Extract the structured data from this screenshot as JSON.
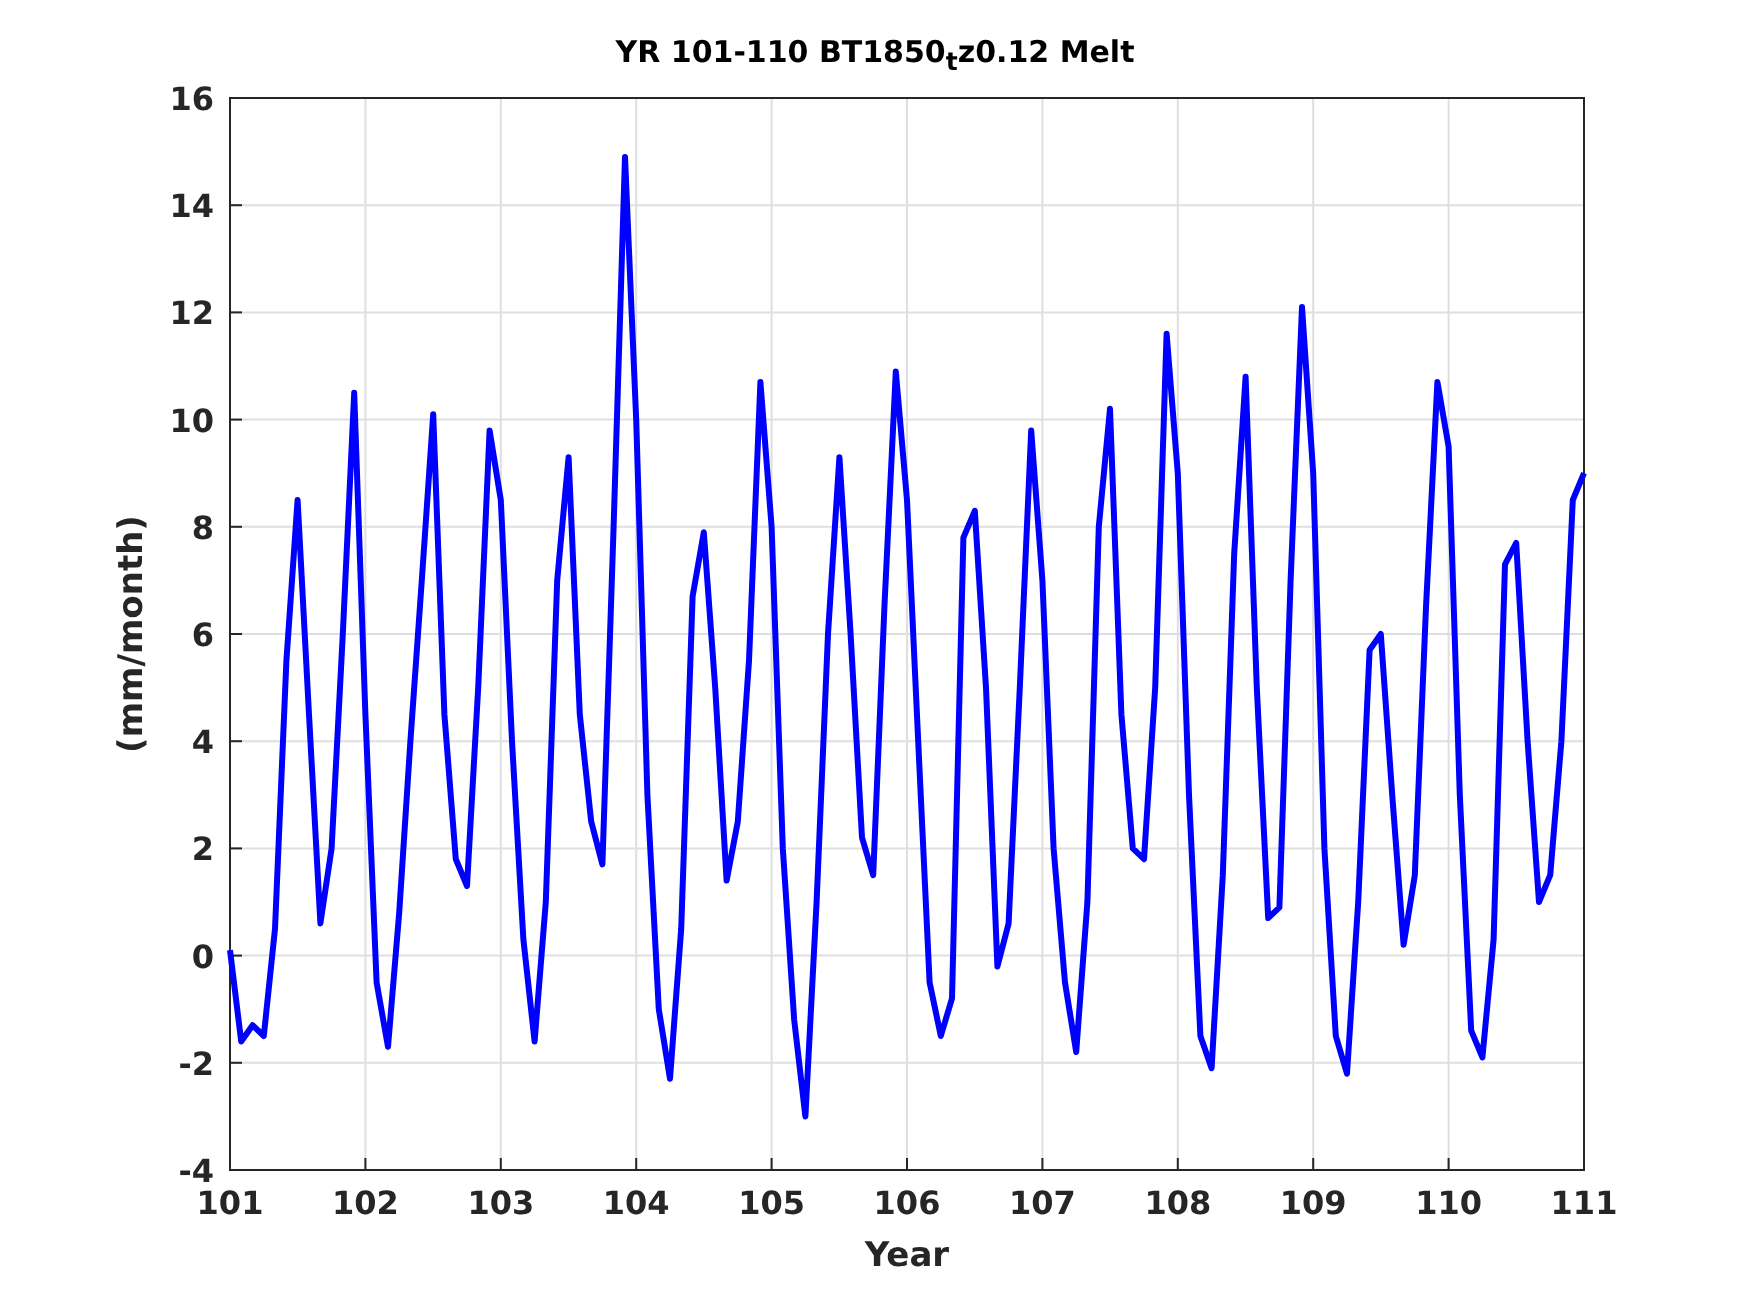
{
  "figure": {
    "chart_data": {
      "type": "line",
      "title": "YR 101-110 BT1850$_{t}$z0.12 Melt",
      "xlabel": "Year",
      "ylabel": "(mm/month)",
      "x": [
        101,
        101.083,
        101.167,
        101.25,
        101.333,
        101.417,
        101.5,
        101.583,
        101.667,
        101.75,
        101.833,
        101.917,
        102,
        102.083,
        102.167,
        102.25,
        102.333,
        102.417,
        102.5,
        102.583,
        102.667,
        102.75,
        102.833,
        102.917,
        103,
        103.083,
        103.167,
        103.25,
        103.333,
        103.417,
        103.5,
        103.583,
        103.667,
        103.75,
        103.833,
        103.917,
        104,
        104.083,
        104.167,
        104.25,
        104.333,
        104.417,
        104.5,
        104.583,
        104.667,
        104.75,
        104.833,
        104.917,
        105,
        105.083,
        105.167,
        105.25,
        105.333,
        105.417,
        105.5,
        105.583,
        105.667,
        105.75,
        105.833,
        105.917,
        106,
        106.083,
        106.167,
        106.25,
        106.333,
        106.417,
        106.5,
        106.583,
        106.667,
        106.75,
        106.833,
        106.917,
        107,
        107.083,
        107.167,
        107.25,
        107.333,
        107.417,
        107.5,
        107.583,
        107.667,
        107.75,
        107.833,
        107.917,
        108,
        108.083,
        108.167,
        108.25,
        108.333,
        108.417,
        108.5,
        108.583,
        108.667,
        108.75,
        108.833,
        108.917,
        109,
        109.083,
        109.167,
        109.25,
        109.333,
        109.417,
        109.5,
        109.583,
        109.667,
        109.75,
        109.833,
        109.917,
        110,
        110.083,
        110.167,
        110.25,
        110.333,
        110.417,
        110.5,
        110.583,
        110.667,
        110.75,
        110.833,
        110.917,
        111
      ],
      "grid": true,
      "series": [
        {
          "color": "#0000ff",
          "values": [
            0.1,
            -1.6,
            -1.3,
            -1.5,
            0.5,
            5.5,
            8.5,
            4.5,
            0.6,
            2,
            6,
            10.5,
            4.5,
            -0.5,
            -1.7,
            0.8,
            4,
            7,
            10.1,
            4.5,
            1.8,
            1.3,
            5,
            9.8,
            8.5,
            4,
            0.3,
            -1.6,
            1,
            7,
            9.3,
            4.5,
            2.5,
            1.7,
            8,
            14.9,
            10,
            3,
            -1,
            -2.3,
            0.5,
            6.7,
            7.9,
            5,
            1.4,
            2.5,
            5.5,
            10.7,
            8,
            2,
            -1.2,
            -3,
            1,
            6,
            9.3,
            6,
            2.2,
            1.5,
            6.5,
            10.9,
            8.5,
            4,
            -0.5,
            -1.5,
            -0.8,
            7.8,
            8.3,
            5,
            -0.2,
            0.6,
            5,
            9.8,
            7,
            2,
            -0.5,
            -1.8,
            1,
            8,
            10.2,
            4.5,
            2,
            1.8,
            5,
            11.6,
            9,
            3,
            -1.5,
            -2.1,
            1.5,
            7.5,
            10.8,
            5,
            0.7,
            0.9,
            7,
            12.1,
            9,
            2,
            -1.5,
            -2.2,
            1,
            5.7,
            6,
            3,
            0.2,
            1.5,
            6.5,
            10.7,
            9.5,
            3,
            -1.4,
            -1.9,
            0.3,
            7.3,
            7.7,
            4,
            1,
            1.5,
            4,
            8.5,
            9
          ]
        }
      ],
      "xlim": [
        101,
        111
      ],
      "ylim": [
        -4,
        16
      ],
      "xticks": [
        101,
        102,
        103,
        104,
        105,
        106,
        107,
        108,
        109,
        110,
        111
      ],
      "yticks": [
        -4,
        -2,
        0,
        2,
        4,
        6,
        8,
        10,
        12,
        14,
        16
      ]
    }
  }
}
